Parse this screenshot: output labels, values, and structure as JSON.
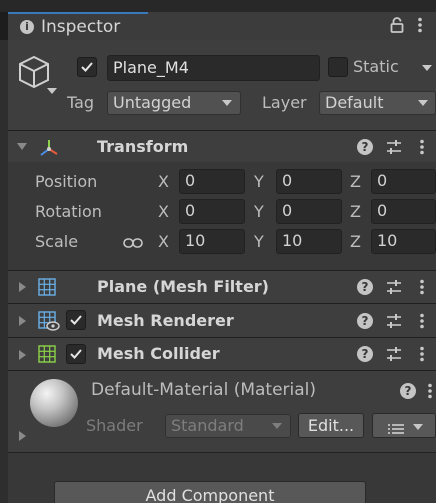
{
  "window": {
    "tab_label": "Inspector",
    "lock_icon": "lock-icon",
    "menu_icon": "kebab-menu-icon"
  },
  "gameobject": {
    "active": true,
    "name": "Plane_M4",
    "static_label": "Static",
    "static_checked": false,
    "tag_label": "Tag",
    "tag_value": "Untagged",
    "layer_label": "Layer",
    "layer_value": "Default"
  },
  "transform": {
    "title": "Transform",
    "expanded": true,
    "position": {
      "label": "Position",
      "x": "0",
      "y": "0",
      "z": "0"
    },
    "rotation": {
      "label": "Rotation",
      "x": "0",
      "y": "0",
      "z": "0"
    },
    "scale": {
      "label": "Scale",
      "x": "10",
      "y": "10",
      "z": "10"
    },
    "axis_x": "X",
    "axis_y": "Y",
    "axis_z": "Z"
  },
  "components": [
    {
      "title": "Plane (Mesh Filter)",
      "has_checkbox": false,
      "icon": "mesh-filter-icon"
    },
    {
      "title": "Mesh Renderer",
      "has_checkbox": true,
      "checked": true,
      "icon": "mesh-renderer-icon"
    },
    {
      "title": "Mesh Collider",
      "has_checkbox": true,
      "checked": true,
      "icon": "mesh-collider-icon"
    }
  ],
  "material": {
    "title": "Default-Material (Material)",
    "shader_label": "Shader",
    "shader_value": "Standard",
    "edit_label": "Edit...",
    "list_icon": "list-icon"
  },
  "footer": {
    "add_component_label": "Add Component"
  },
  "colors": {
    "background": "#383838",
    "header": "#3e3e3e",
    "field": "#2a2a2a",
    "accent_tab": "#3a79bb"
  }
}
